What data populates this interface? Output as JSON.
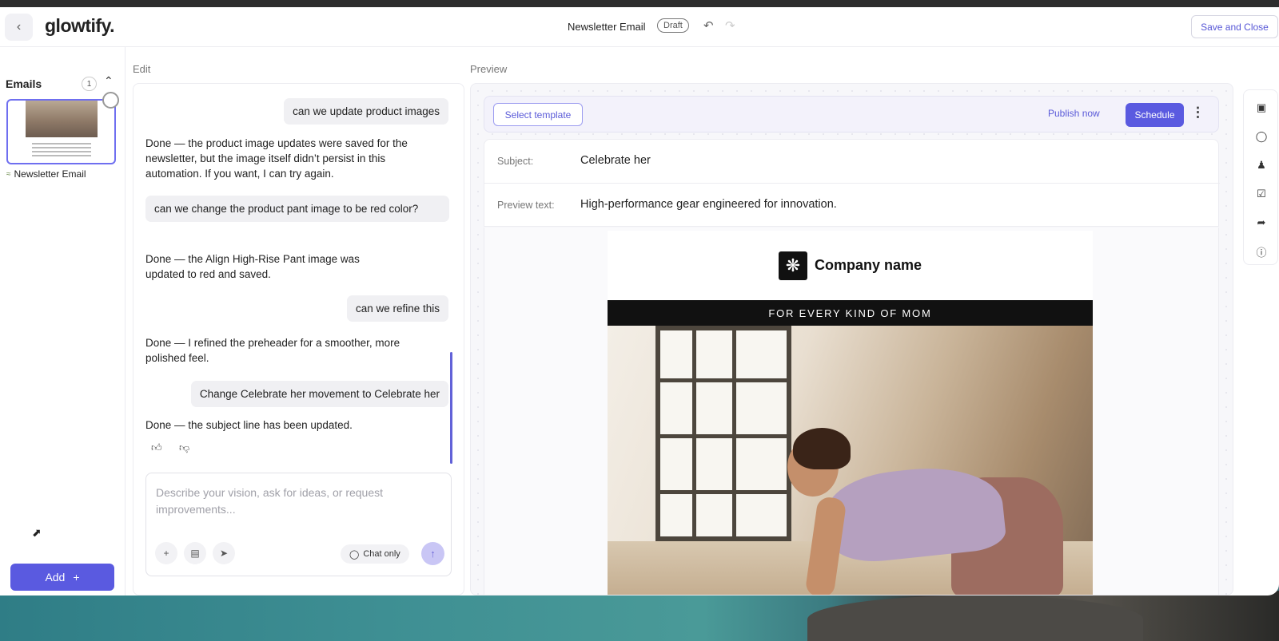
{
  "app": {
    "logo": "glowtify.",
    "back_icon": "chevron-left-icon"
  },
  "topbar": {
    "doc_title": "Newsletter Email",
    "status_badge": "Draft",
    "undo_icon": "undo-icon",
    "redo_icon": "redo-icon",
    "save_close_label": "Save and Close"
  },
  "sidebar": {
    "title": "Emails",
    "count": "1",
    "email_item_label": "Newsletter Email",
    "add_label": "Add"
  },
  "edit": {
    "label": "Edit",
    "messages": [
      {
        "role": "user",
        "text": "can we update product images"
      },
      {
        "role": "ai",
        "text": "Done — the product image updates were saved for the newsletter, but the image itself didn’t persist in this automation. If you want, I can try again."
      },
      {
        "role": "user",
        "text": "can we change the product pant image to be red color?"
      },
      {
        "role": "ai",
        "text": "Done — the Align High‑Rise Pant image was updated to red and saved."
      },
      {
        "role": "user",
        "text": "can we refine this"
      },
      {
        "role": "ai",
        "text": "Done — I refined the preheader for a smoother, more polished feel."
      },
      {
        "role": "user",
        "text": "Change Celebrate her movement to Celebrate her"
      },
      {
        "role": "ai",
        "text": "Done — the subject line has been updated."
      }
    ],
    "composer_placeholder": "Describe your vision, ask for ideas, or request improvements...",
    "chat_only_label": "Chat only"
  },
  "preview": {
    "label": "Preview",
    "select_template_label": "Select template",
    "publish_now_label": "Publish now",
    "schedule_label": "Schedule",
    "subject_key": "Subject:",
    "subject_value": "Celebrate her",
    "preview_text_key": "Preview text:",
    "preview_text_value": "High-performance gear engineered for innovation.",
    "email": {
      "company_name": "Company name",
      "banner": "FOR EVERY KIND OF MOM"
    }
  },
  "colors": {
    "accent": "#5a5ae0",
    "accent_text": "#5a5ad8"
  }
}
